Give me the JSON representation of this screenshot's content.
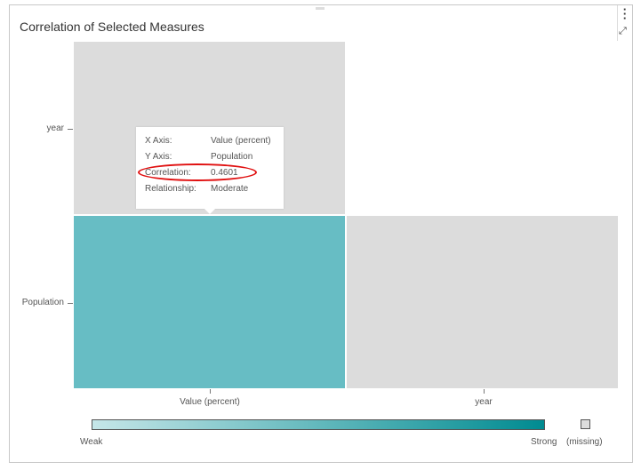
{
  "title": "Correlation of Selected Measures",
  "icons": {
    "menu": "vertical-ellipsis-icon",
    "maximize": "expand-icon"
  },
  "chart_data": {
    "type": "heatmap",
    "x_categories": [
      "Value (percent)",
      "year"
    ],
    "y_categories": [
      "year",
      "Population"
    ],
    "cells": [
      {
        "x": "Value (percent)",
        "y": "year",
        "correlation": null,
        "relationship": "missing"
      },
      {
        "x": "Value (percent)",
        "y": "Population",
        "correlation": 0.4601,
        "relationship": "Moderate"
      },
      {
        "x": "year",
        "y": "Population",
        "correlation": null,
        "relationship": "missing"
      }
    ],
    "colors": {
      "weak": "#c5e6e8",
      "strong": "#008b91",
      "moderate": "#67bdc4",
      "missing": "#dcdcdc"
    },
    "legend": {
      "weak_label": "Weak",
      "strong_label": "Strong",
      "missing_label": "(missing)",
      "placement": "bottom"
    }
  },
  "tooltip": {
    "rows": [
      {
        "key": "X Axis:",
        "value": "Value (percent)"
      },
      {
        "key": "Y Axis:",
        "value": "Population"
      },
      {
        "key": "Correlation:",
        "value": "0.4601"
      },
      {
        "key": "Relationship:",
        "value": "Moderate"
      }
    ],
    "highlight_color": "#e01010"
  }
}
